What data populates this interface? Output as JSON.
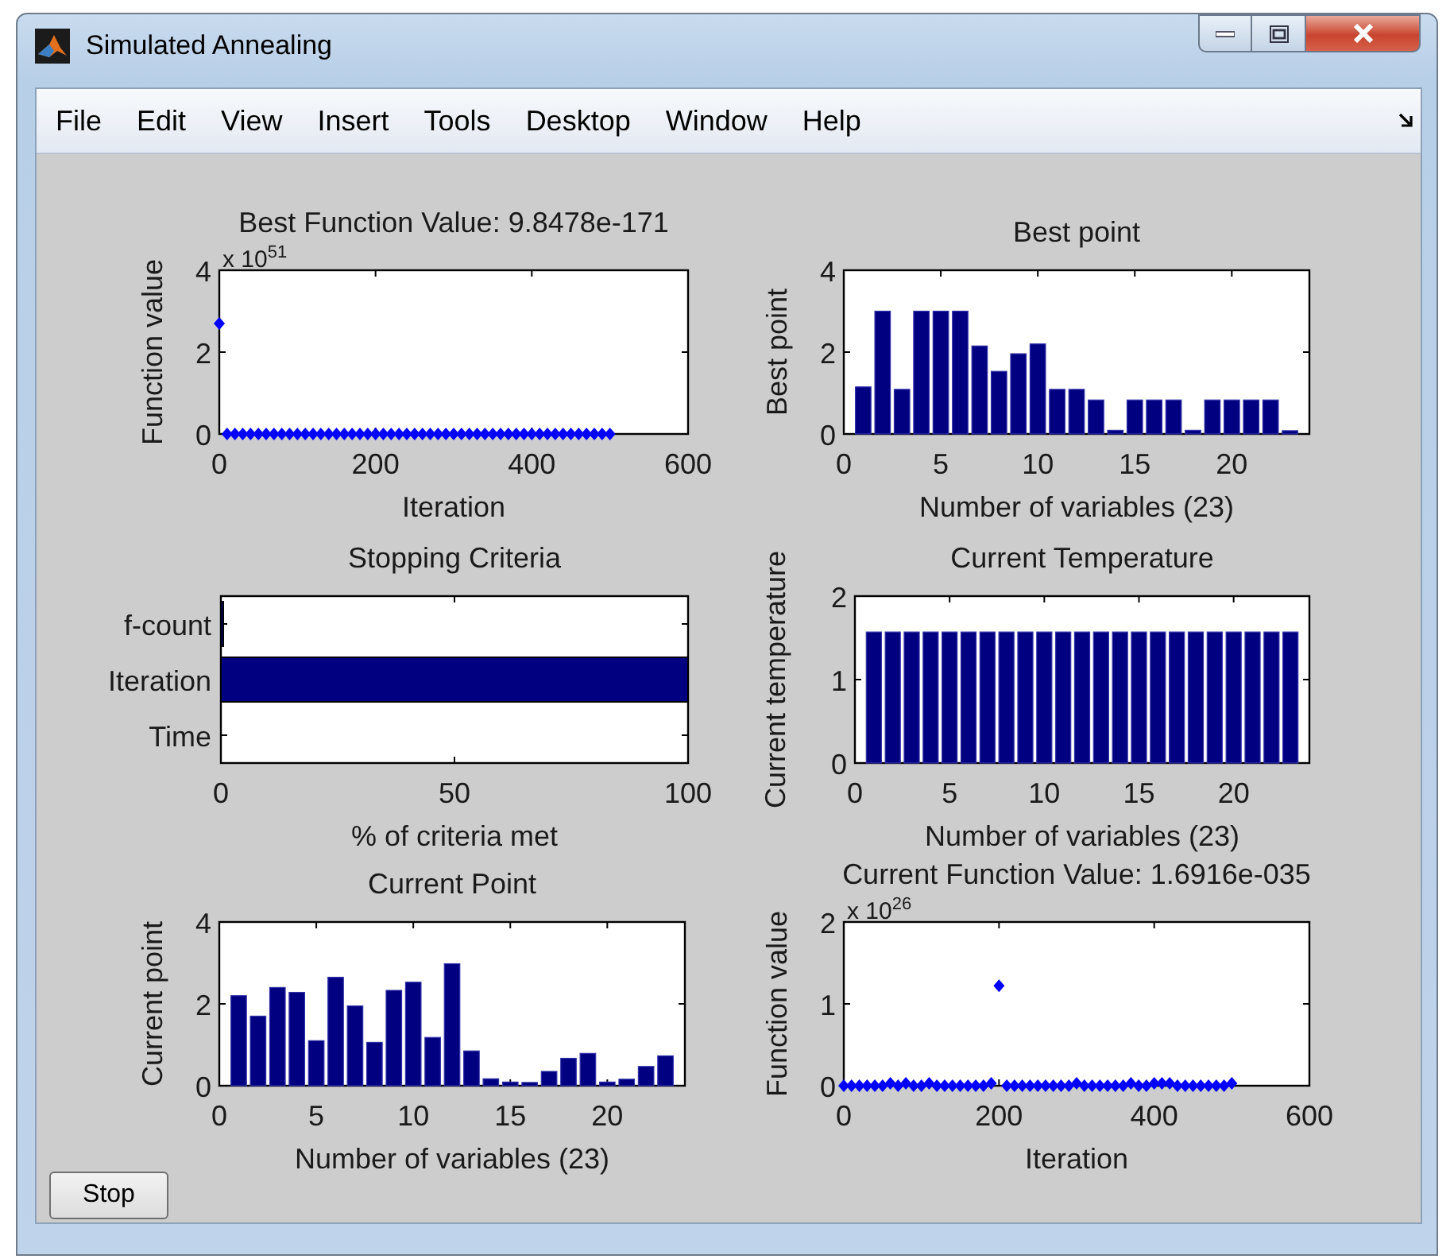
{
  "window": {
    "title": "Simulated Annealing"
  },
  "menu": [
    "File",
    "Edit",
    "View",
    "Insert",
    "Tools",
    "Desktop",
    "Window",
    "Help"
  ],
  "plots": [
    {
      "chart_data": {
        "type": "scatter",
        "title": "Best Function Value: 9.8478e-171",
        "xlabel": "Iteration",
        "ylabel": "Function value",
        "xlim": [
          0,
          600
        ],
        "ylim": [
          0,
          4
        ],
        "xticks": [
          0,
          200,
          400,
          600
        ],
        "yticks": [
          0,
          2,
          4
        ],
        "annotations": [
          {
            "text": "x 10$^{51}$"
          }
        ],
        "x": [
          0,
          10,
          20,
          30,
          40,
          50,
          60,
          70,
          80,
          90,
          100,
          110,
          120,
          130,
          140,
          150,
          160,
          170,
          180,
          190,
          200,
          210,
          220,
          230,
          240,
          250,
          260,
          270,
          280,
          290,
          300,
          310,
          320,
          330,
          340,
          350,
          360,
          370,
          380,
          390,
          400,
          410,
          420,
          430,
          440,
          450,
          460,
          470,
          480,
          490,
          500
        ],
        "series": [
          {
            "color": "#0000ff",
            "values": [
              2.7,
              0,
              0,
              0,
              0,
              0,
              0,
              0,
              0,
              0,
              0,
              0,
              0,
              0,
              0,
              0,
              0,
              0,
              0,
              0,
              0,
              0,
              0,
              0,
              0,
              0,
              0,
              0,
              0,
              0,
              0,
              0,
              0,
              0,
              0,
              0,
              0,
              0,
              0,
              0,
              0,
              0,
              0,
              0,
              0,
              0,
              0,
              0,
              0,
              0,
              0
            ]
          }
        ]
      }
    },
    {
      "chart_data": {
        "type": "bar",
        "title": "Best point",
        "xlabel": "Number of variables (23)",
        "ylabel": "Best point",
        "xlim": [
          0,
          24
        ],
        "ylim": [
          0,
          4
        ],
        "xticks": [
          0,
          5,
          10,
          15,
          20
        ],
        "yticks": [
          0,
          2,
          4
        ],
        "x": [
          1,
          2,
          3,
          4,
          5,
          6,
          7,
          8,
          9,
          10,
          11,
          12,
          13,
          14,
          15,
          16,
          17,
          18,
          19,
          20,
          21,
          22,
          23
        ],
        "series": [
          {
            "color": "#000080",
            "values": [
              1.15,
              3.0,
              1.09,
              3.0,
              3.0,
              3.0,
              2.15,
              1.53,
              1.96,
              2.2,
              1.09,
              1.09,
              0.83,
              0.09,
              0.83,
              0.83,
              0.83,
              0.09,
              0.83,
              0.83,
              0.83,
              0.83,
              0.08
            ]
          }
        ]
      }
    },
    {
      "chart_data": {
        "type": "bar",
        "orientation": "horizontal",
        "title": "Stopping Criteria",
        "xlabel": "% of criteria met",
        "xlim": [
          0,
          100
        ],
        "xticks": [
          0,
          50,
          100
        ],
        "categories": [
          "f-count",
          "Iteration",
          "Time"
        ],
        "series": [
          {
            "color": "#000080",
            "values": [
              0.5,
              100,
              0
            ]
          }
        ]
      }
    },
    {
      "chart_data": {
        "type": "bar",
        "title": "Current Temperature",
        "xlabel": "Number of variables (23)",
        "ylabel": "Current temperature",
        "xlim": [
          0,
          24
        ],
        "ylim": [
          0,
          2
        ],
        "xticks": [
          0,
          5,
          10,
          15,
          20
        ],
        "yticks": [
          0,
          1,
          2
        ],
        "x": [
          1,
          2,
          3,
          4,
          5,
          6,
          7,
          8,
          9,
          10,
          11,
          12,
          13,
          14,
          15,
          16,
          17,
          18,
          19,
          20,
          21,
          22,
          23
        ],
        "series": [
          {
            "color": "#000080",
            "values": [
              1.57,
              1.57,
              1.57,
              1.57,
              1.57,
              1.57,
              1.57,
              1.57,
              1.57,
              1.57,
              1.57,
              1.57,
              1.57,
              1.57,
              1.57,
              1.57,
              1.57,
              1.57,
              1.57,
              1.57,
              1.57,
              1.57,
              1.57
            ]
          }
        ]
      }
    },
    {
      "chart_data": {
        "type": "bar",
        "title": "Current Point",
        "xlabel": "Number of variables (23)",
        "ylabel": "Current point",
        "xlim": [
          0,
          24
        ],
        "ylim": [
          0,
          4
        ],
        "xticks": [
          0,
          5,
          10,
          15,
          20
        ],
        "yticks": [
          0,
          2,
          4
        ],
        "x": [
          1,
          2,
          3,
          4,
          5,
          6,
          7,
          8,
          9,
          10,
          11,
          12,
          13,
          14,
          15,
          16,
          17,
          18,
          19,
          20,
          21,
          22,
          23
        ],
        "series": [
          {
            "color": "#000080",
            "values": [
              2.2,
              1.7,
              2.4,
              2.28,
              1.1,
              2.65,
              1.95,
              1.06,
              2.33,
              2.53,
              1.18,
              2.98,
              0.85,
              0.17,
              0.09,
              0.08,
              0.35,
              0.67,
              0.79,
              0.09,
              0.16,
              0.47,
              0.73
            ]
          }
        ]
      }
    },
    {
      "chart_data": {
        "type": "scatter",
        "title": "Current Function Value: 1.6916e-035",
        "xlabel": "Iteration",
        "ylabel": "Function value",
        "xlim": [
          0,
          600
        ],
        "ylim": [
          0,
          2
        ],
        "xticks": [
          0,
          200,
          400,
          600
        ],
        "yticks": [
          0,
          1,
          2
        ],
        "annotations": [
          {
            "text": "x 10$^{26}$"
          }
        ],
        "x": [
          0,
          10,
          20,
          30,
          40,
          50,
          60,
          70,
          80,
          90,
          100,
          110,
          120,
          130,
          140,
          150,
          160,
          170,
          180,
          190,
          200,
          210,
          220,
          230,
          240,
          250,
          260,
          270,
          280,
          290,
          300,
          310,
          320,
          330,
          340,
          350,
          360,
          370,
          380,
          390,
          400,
          410,
          420,
          430,
          440,
          450,
          460,
          470,
          480,
          490,
          500
        ],
        "series": [
          {
            "color": "#0000ff",
            "values": [
              0,
              0,
              0,
              0,
              0,
              0,
              0.03,
              0,
              0.03,
              0,
              0,
              0.03,
              0,
              0,
              0,
              0,
              0,
              0,
              0,
              0.03,
              1.22,
              0,
              0,
              0,
              0,
              0,
              0,
              0,
              0,
              0,
              0.03,
              0,
              0,
              0,
              0,
              0,
              0,
              0.03,
              0,
              0,
              0.03,
              0.03,
              0.03,
              0,
              0,
              0,
              0,
              0,
              0,
              0,
              0.03
            ]
          }
        ]
      }
    }
  ],
  "stop_button": "Stop"
}
